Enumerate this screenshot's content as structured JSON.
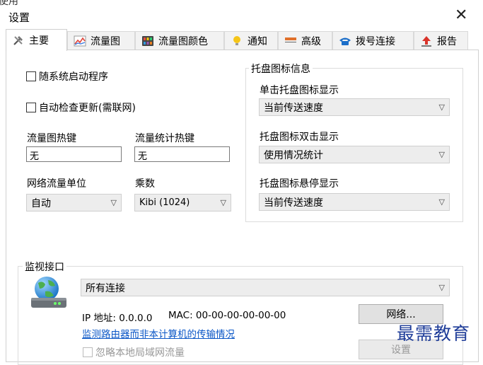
{
  "window": {
    "title": "设置",
    "top_cut_text": "使用"
  },
  "tabs": [
    {
      "label": "主要",
      "icon": "tools-icon",
      "active": true
    },
    {
      "label": "流量图",
      "icon": "line-chart-icon"
    },
    {
      "label": "流量图颜色",
      "icon": "color-grid-icon"
    },
    {
      "label": "通知",
      "icon": "lightbulb-icon"
    },
    {
      "label": "高级",
      "icon": "advanced-icon"
    },
    {
      "label": "拨号连接",
      "icon": "telephone-icon"
    },
    {
      "label": "报告",
      "icon": "upload-arrow-icon"
    }
  ],
  "main": {
    "startup_label": "随系统启动程序",
    "update_label": "自动检查更新(需联网)",
    "graph_hotkey_label": "流量图热键",
    "graph_hotkey_value": "无",
    "stats_hotkey_label": "流量统计热键",
    "stats_hotkey_value": "无",
    "unit_label": "网络流量单位",
    "unit_value": "自动",
    "multiplier_label": "乘数",
    "multiplier_value": "Kibi (1024)"
  },
  "tray": {
    "group_title": "托盘图标信息",
    "single_click_label": "单击托盘图标显示",
    "single_click_value": "当前传送速度",
    "double_click_label": "托盘图标双击显示",
    "double_click_value": "使用情况统计",
    "hover_label": "托盘图标悬停显示",
    "hover_value": "当前传送速度"
  },
  "monitor": {
    "group_title": "监视接口",
    "interface_value": "所有连接",
    "ip_text": "IP 地址: 0.0.0.0",
    "mac_text": "MAC: 00-00-00-00-00-00",
    "network_button": "网络...",
    "router_link": "监测路由器而非本计算机的传输情况",
    "ignore_lan_label": "忽略本地局域网流量",
    "settings_button": "设置"
  },
  "watermark": "最需教育",
  "colors": {
    "link": "#0b57c7",
    "watermark": "#1f3d99"
  }
}
